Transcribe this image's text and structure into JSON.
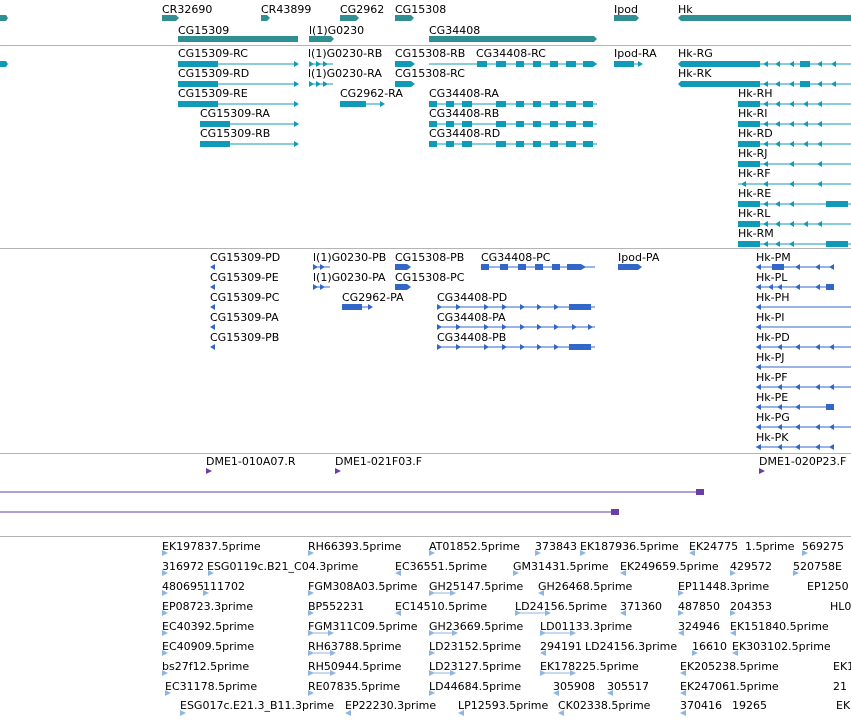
{
  "colors": {
    "gene": "#2f8f93",
    "rna_curated": "#0f9bb8",
    "rna_predicted": "#3267c8",
    "clone": "#6a3ea5",
    "est": "#8fb6e0",
    "separator": "#b4b4b4"
  },
  "tracks": {
    "genes": {
      "labels": [
        "CR32690",
        "CR43899",
        "CG2962",
        "CG15308",
        "CG15309",
        "l(1)G0230",
        "CG34408",
        "Ipod",
        "Hk"
      ]
    },
    "transcripts_a": {
      "labels": [
        "CG15309-RC",
        "CG15309-RD",
        "CG15309-RE",
        "CG15309-RA",
        "CG15309-RB",
        "l(1)G0230-RB",
        "l(1)G0230-RA",
        "CG15308-RB",
        "CG15308-RC",
        "CG2962-RA",
        "CG34408-RC",
        "CG34408-RA",
        "CG34408-RB",
        "CG34408-RD",
        "Ipod-RA",
        "Hk-RG",
        "Hk-RK",
        "Hk-RH",
        "Hk-RI",
        "Hk-RD",
        "Hk-RJ",
        "Hk-RF",
        "Hk-RE",
        "Hk-RL",
        "Hk-RM"
      ]
    },
    "transcripts_b": {
      "labels": [
        "CG15309-PD",
        "CG15309-PE",
        "CG15309-PC",
        "CG15309-PA",
        "CG15309-PB",
        "l(1)G0230-PB",
        "l(1)G0230-PA",
        "CG15308-PB",
        "CG15308-PC",
        "CG2962-PA",
        "CG34408-PC",
        "CG34408-PD",
        "CG34408-PA",
        "CG34408-PB",
        "Ipod-PA",
        "Hk-PM",
        "Hk-PL",
        "Hk-PH",
        "Hk-PI",
        "Hk-PD",
        "Hk-PJ",
        "Hk-PF",
        "Hk-PE",
        "Hk-PG",
        "Hk-PK"
      ]
    },
    "clones": {
      "labels": [
        "DME1-010A07.R",
        "DME1-021F03.F",
        "DME1-020P23.F"
      ]
    },
    "ests": {
      "labels": [
        "EK197837.5prime",
        "RH66393.5prime",
        "AT01852.5prime",
        "373843",
        "EK187936.5prime",
        "EK24775",
        "1.5prime",
        "569275",
        "316972",
        "ESG0119c.B21_C04.3prime",
        "EC36551.5prime",
        "GM31431.5prime",
        "EK249659.5prime",
        "429572",
        "520758E",
        "480695",
        "111702",
        "FGM308A03.5prime",
        "GH25147.5prime",
        "GH26468.5prime",
        "EP11448.3prime",
        "EP1250",
        "EP08723.3prime",
        "BP552231",
        "EC14510.5prime",
        "LD24156.5prime",
        "371360",
        "487850",
        "204353",
        "HL0",
        "EC40392.5prime",
        "FGM311C09.5prime",
        "GH23669.5prime",
        "LD01133.3prime",
        "324946",
        "EK151840.5prime",
        "EC40909.5prime",
        "RH63788.5prime",
        "LD23152.5prime",
        "294191",
        "LD24156.3prime",
        "16610",
        "EK303102.5prime",
        "bs27f12.5prime",
        "RH50944.5prime",
        "LD23127.5prime",
        "EK178225.5prime",
        "EK205238.5prime",
        "EK1",
        "EC31178.5prime",
        "RE07835.5prime",
        "LD44684.5prime",
        "305908",
        "305517",
        "EK247061.5prime",
        "21",
        "ESG017c.E21.3_B11.3prime",
        "EP22230.3prime",
        "LP12593.5prime",
        "CK02338.5prime",
        "370416",
        "19265",
        "EK"
      ]
    }
  }
}
